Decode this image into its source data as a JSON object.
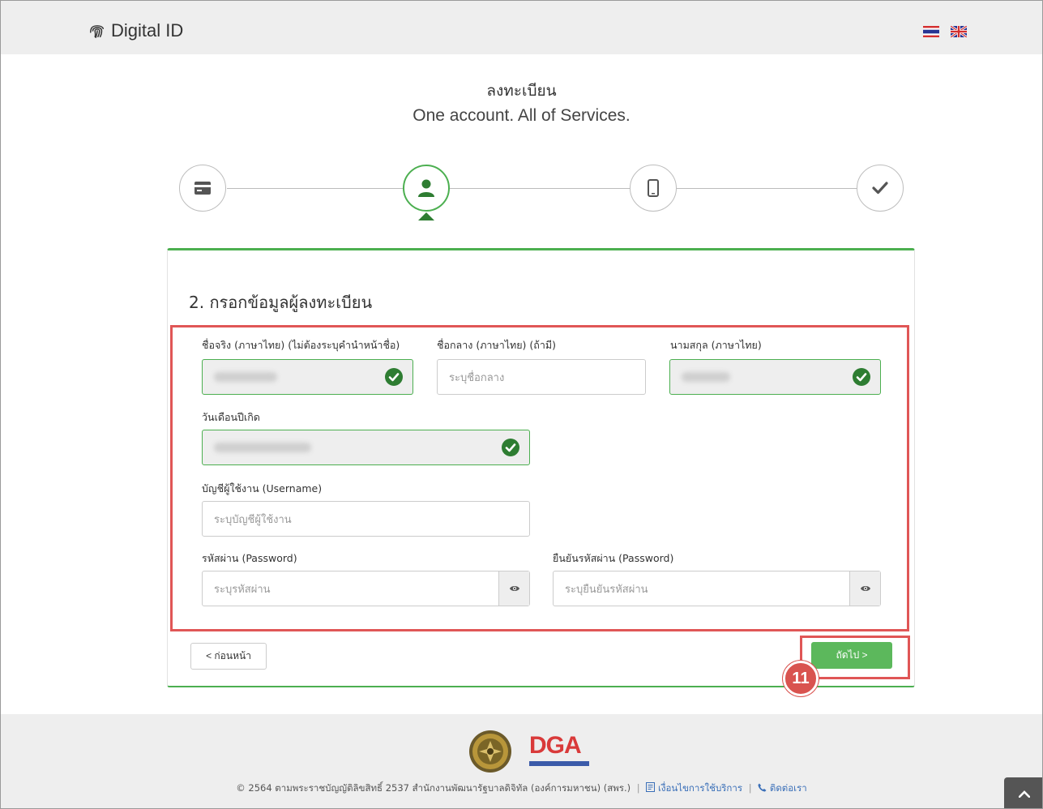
{
  "header": {
    "brand": "Digital ID",
    "languages": [
      {
        "code": "th",
        "label": "Thai"
      },
      {
        "code": "en",
        "label": "English"
      }
    ]
  },
  "titles": {
    "main": "ลงทะเบียน",
    "tagline": "One account. All of Services."
  },
  "stepper": {
    "steps": [
      {
        "icon": "id-card-icon",
        "state": "inactive"
      },
      {
        "icon": "user-icon",
        "state": "active"
      },
      {
        "icon": "mobile-icon",
        "state": "inactive"
      },
      {
        "icon": "checkmark-icon",
        "state": "inactive"
      }
    ],
    "active_color": "#4caf50"
  },
  "form": {
    "section_title": "2. กรอกข้อมูลผู้ลงทะเบียน",
    "first_name": {
      "label": "ชื่อจริง (ภาษาไทย) (ไม่ต้องระบุคำนำหน้าชื่อ)",
      "value": "",
      "state": "valid"
    },
    "middle_name": {
      "label": "ชื่อกลาง (ภาษาไทย) (ถ้ามี)",
      "placeholder": "ระบุชื่อกลาง"
    },
    "last_name": {
      "label": "นามสกุล (ภาษาไทย)",
      "value": "",
      "state": "valid"
    },
    "birth_date": {
      "label": "วันเดือนปีเกิด",
      "value": "",
      "state": "valid"
    },
    "username": {
      "label": "บัญชีผู้ใช้งาน (Username)",
      "placeholder": "ระบุบัญชีผู้ใช้งาน"
    },
    "password": {
      "label": "รหัสผ่าน (Password)",
      "placeholder": "ระบุรหัสผ่าน"
    },
    "confirm_password": {
      "label": "ยืนยันรหัสผ่าน (Password)",
      "placeholder": "ระบุยืนยันรหัสผ่าน"
    }
  },
  "buttons": {
    "back": "< ก่อนหน้า",
    "next": "ถัดไป >"
  },
  "annotation": {
    "marker": "11",
    "color": "#e05656"
  },
  "footer": {
    "logo_text": "DGA",
    "copyright": "© 2564 ตามพระราชบัญญัติลิขสิทธิ์ 2537 สำนักงานพัฒนารัฐบาลดิจิทัล (องค์การมหาชน) (สพร.)",
    "terms_link": "เงื่อนไขการใช้บริการ",
    "contact_link": "ติดต่อเรา"
  }
}
